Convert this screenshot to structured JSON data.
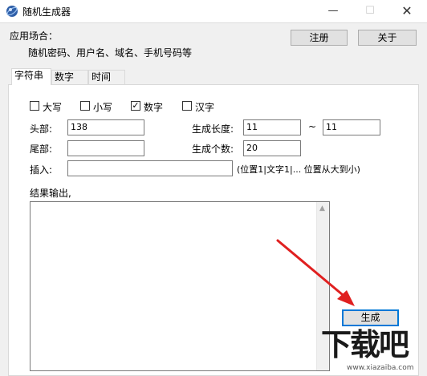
{
  "window": {
    "title": "随机生成器",
    "minimize": "—",
    "maximize": "☐",
    "close": "✕"
  },
  "header": {
    "usage_label": "应用场合：",
    "usage_text": "随机密码、用户名、域名、手机号码等",
    "register_button": "注册",
    "about_button": "关于"
  },
  "tabs": [
    {
      "label": "字符串",
      "active": true
    },
    {
      "label": "数字",
      "active": false
    },
    {
      "label": "时间",
      "active": false
    }
  ],
  "options": [
    {
      "label": "大写",
      "checked": false
    },
    {
      "label": "小写",
      "checked": false
    },
    {
      "label": "数字",
      "checked": true
    },
    {
      "label": "汉字",
      "checked": false
    }
  ],
  "checkmark": "✓",
  "form": {
    "head_label": "头部:",
    "head_value": "138",
    "tail_label": "尾部:",
    "tail_value": "",
    "insert_label": "插入:",
    "insert_value": "",
    "insert_hint": "(位置1|文字1|... 位置从大到小)",
    "length_label": "生成长度:",
    "length_min": "11",
    "length_sep": "~",
    "length_max": "11",
    "count_label": "生成个数:",
    "count_value": "20"
  },
  "output": {
    "label": "结果输出,",
    "value": ""
  },
  "generate_button": "生成",
  "watermark": {
    "text": "下载吧",
    "url": "www.xiazaiba.com"
  },
  "colors": {
    "accent": "#0078d7",
    "arrow": "#e02020"
  }
}
